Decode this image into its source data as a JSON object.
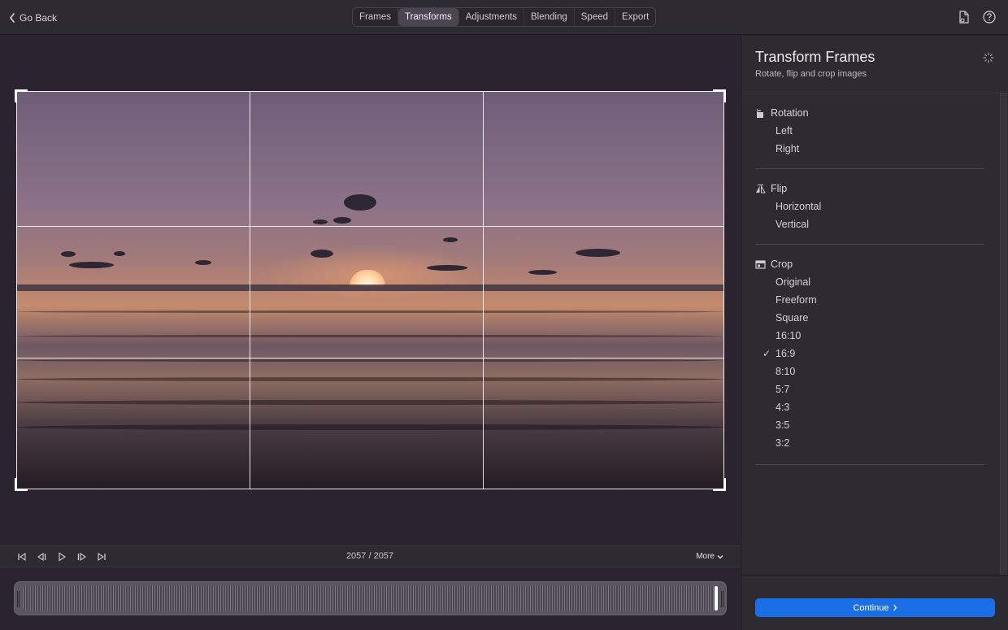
{
  "topbar": {
    "back_label": "Go Back",
    "tabs": [
      {
        "label": "Frames"
      },
      {
        "label": "Transforms"
      },
      {
        "label": "Adjustments"
      },
      {
        "label": "Blending"
      },
      {
        "label": "Speed"
      },
      {
        "label": "Export"
      }
    ],
    "active_tab": "Transforms",
    "right_icons": [
      "document-export-icon",
      "help-icon"
    ]
  },
  "preview": {
    "image_description_icon": "crop-grid",
    "grid": "rule-of-thirds"
  },
  "playback": {
    "controls": [
      "skip-to-start-icon",
      "step-back-icon",
      "play-icon",
      "step-forward-icon",
      "skip-to-end-icon"
    ],
    "frame_counter": "2057 / 2057",
    "more_label": "More"
  },
  "sidebar": {
    "title": "Transform Frames",
    "subtitle": "Rotate, flip and crop images",
    "sections": {
      "rotation": {
        "label": "Rotation",
        "icon": "rotate-icon",
        "options": [
          "Left",
          "Right"
        ]
      },
      "flip": {
        "label": "Flip",
        "icon": "flip-icon",
        "options": [
          "Horizontal",
          "Vertical"
        ]
      },
      "crop": {
        "label": "Crop",
        "icon": "crop-icon",
        "options": [
          "Original",
          "Freeform",
          "Square",
          "16:10",
          "16:9",
          "8:10",
          "5:7",
          "4:3",
          "3:5",
          "3:2"
        ],
        "selected": "16:9"
      }
    },
    "continue_label": "Continue"
  },
  "colors": {
    "accent": "#1a6ee6",
    "background": "#2b2430",
    "panel": "#2e2a31"
  }
}
